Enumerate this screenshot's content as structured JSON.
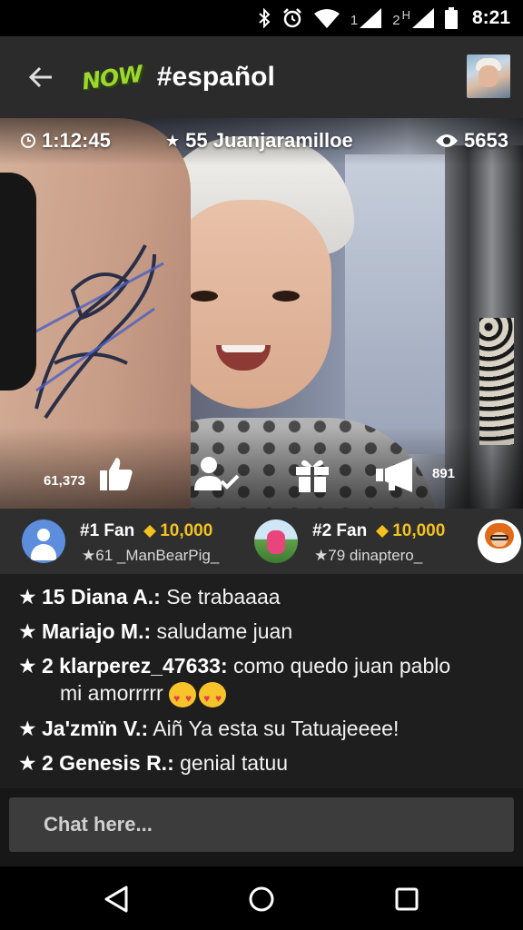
{
  "status_bar": {
    "time": "8:21",
    "sim1_label": "1",
    "sim2_label": "2",
    "sim2_network": "H",
    "icons": [
      "bluetooth-icon",
      "alarm-icon",
      "wifi-icon",
      "signal-icon",
      "signal-icon",
      "battery-icon"
    ]
  },
  "app_bar": {
    "logo_text": "NOW",
    "channel_title": "#español",
    "accent_color": "#9bd72e"
  },
  "stream": {
    "elapsed_time": "1:12:45",
    "host_label": "55 Juanjaramilloe",
    "viewer_count": "5653",
    "like_count": "61,373",
    "shout_count": "891"
  },
  "fans": [
    {
      "rank_label": "#1 Fan",
      "coins": "10,000",
      "user": "★61 _ManBearPig_"
    },
    {
      "rank_label": "#2 Fan",
      "coins": "10,000",
      "user": "★79 dinaptero_"
    }
  ],
  "chat": {
    "messages": [
      {
        "star": "★",
        "user": "15 Diana A.:",
        "text": "Se trabaaaa"
      },
      {
        "star": "★",
        "user": "Mariajo M.:",
        "text": "saludame juan"
      },
      {
        "star": "★",
        "user": "2 klarperez_47633:",
        "text": "como quedo juan pablo",
        "text_line2": "mi amorrrrr"
      },
      {
        "star": "★",
        "user": "Ja'zmïn V.:",
        "text": "Aiñ Ya esta su Tatuajeeee!"
      },
      {
        "star": "★",
        "user": "2 Genesis R.:",
        "text": "genial tatuu"
      }
    ],
    "input_placeholder": "Chat here..."
  },
  "colors": {
    "coin_color": "#f4c21f",
    "background": "#1e1e1e",
    "fans_bar": "#2f2f2f"
  }
}
